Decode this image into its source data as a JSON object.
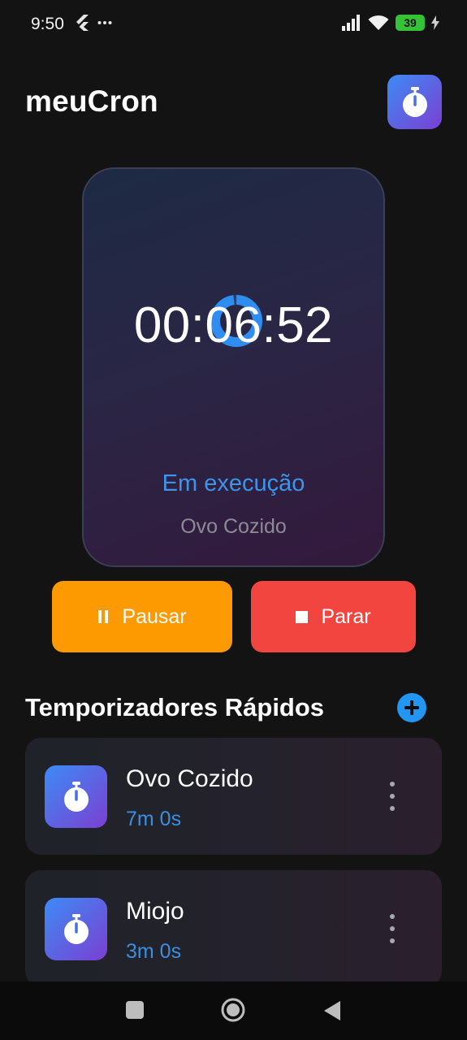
{
  "status_bar": {
    "time": "9:50",
    "battery": "39",
    "icons": [
      "flutter-icon",
      "more-dots-icon",
      "signal-icon",
      "wifi-icon",
      "battery-icon",
      "charging-icon"
    ]
  },
  "app": {
    "title": "meuCron",
    "logo_icon": "stopwatch-icon"
  },
  "timer": {
    "time": "00:06:52",
    "status": "Em execução",
    "name": "Ovo Cozido",
    "progress": 0.98,
    "status_color": "#3c95ea"
  },
  "controls": {
    "pause_label": "Pausar",
    "stop_label": "Parar",
    "pause_color": "#fd9a02",
    "stop_color": "#f34540"
  },
  "quick_timers": {
    "title": "Temporizadores Rápidos",
    "items": [
      {
        "name": "Ovo Cozido",
        "duration": "7m 0s"
      },
      {
        "name": "Miojo",
        "duration": "3m 0s"
      }
    ]
  },
  "nav_bar": {
    "icons": [
      "recents-square-icon",
      "home-circle-icon",
      "back-triangle-icon"
    ]
  }
}
